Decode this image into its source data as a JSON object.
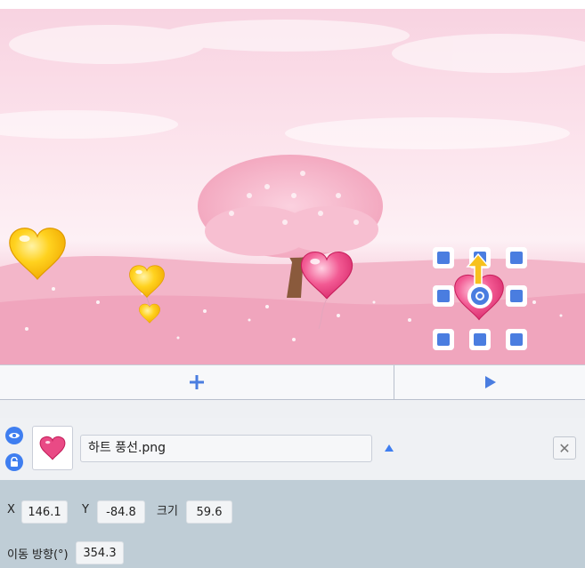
{
  "toolbar": {
    "add_icon": "plus-icon",
    "play_icon": "play-icon"
  },
  "sprite": {
    "name": "하트 풍선.png",
    "visibility_icon": "eye-icon",
    "lock_icon": "lock-icon",
    "thumbnail_icon": "heart-balloon-icon",
    "collapse_icon": "caret-up-icon",
    "close_label": "✕"
  },
  "properties": {
    "x_label": "X",
    "x_value": "146.1",
    "y_label": "Y",
    "y_value": "-84.8",
    "size_label": "크기",
    "size_value": "59.6",
    "direction_label": "이동 방향(°)",
    "direction_value": "354.3"
  },
  "colors": {
    "accent": "#3f7ef0",
    "stage_pink": "#f6c6d6",
    "panel": "#bfcdd6"
  }
}
